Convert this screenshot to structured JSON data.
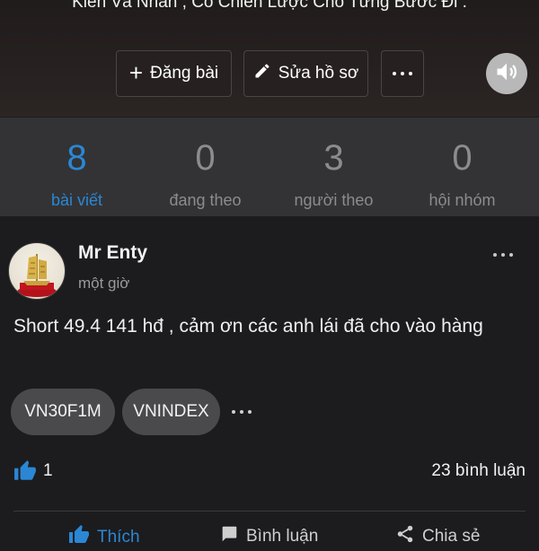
{
  "profile": {
    "bio": "Kiên Và Nhẫn , Có Chiến Lược Cho Từng Bước Đi .",
    "post_button": "Đăng bài",
    "edit_button": "Sửa hồ sơ"
  },
  "stats": [
    {
      "value": "8",
      "label": "bài viết"
    },
    {
      "value": "0",
      "label": "đang theo"
    },
    {
      "value": "3",
      "label": "người theo"
    },
    {
      "value": "0",
      "label": "hội nhóm"
    }
  ],
  "post": {
    "author": "Mr Enty",
    "time": "một giờ",
    "body": "Short 49.4  141 hđ , cảm ơn các anh lái đã cho vào hàng",
    "tags": [
      "VN30F1M",
      "VNINDEX"
    ],
    "likes": "1",
    "comments": "23 bình luận",
    "actions": {
      "like": "Thích",
      "comment": "Bình luận",
      "share": "Chia sẻ"
    }
  },
  "colors": {
    "accent": "#2b87d4",
    "background": "#1c1c1e",
    "stats_background": "#333335"
  },
  "icons": [
    "plus-icon",
    "pencil-icon",
    "more-icon",
    "speaker-icon",
    "thumbs-up-icon",
    "comment-icon",
    "share-icon"
  ]
}
